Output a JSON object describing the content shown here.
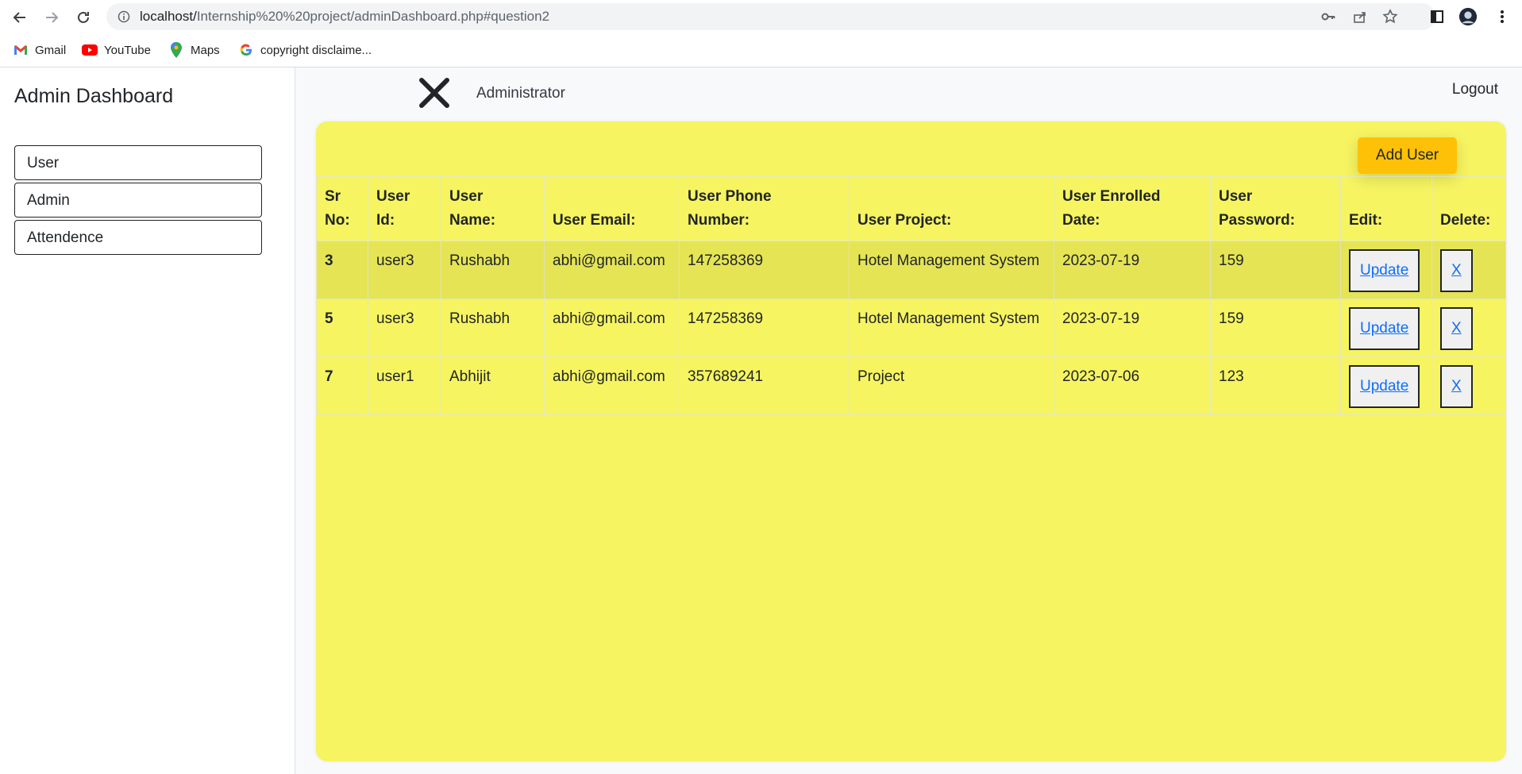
{
  "browser": {
    "url_host": "localhost/",
    "url_path": "Internship%20%20project/adminDashboard.php#question2",
    "bookmarks": [
      {
        "label": "Gmail",
        "icon": "gmail-icon"
      },
      {
        "label": "YouTube",
        "icon": "youtube-icon"
      },
      {
        "label": "Maps",
        "icon": "maps-icon"
      },
      {
        "label": "copyright disclaime...",
        "icon": "google-icon"
      }
    ]
  },
  "sidebar": {
    "title": "Admin Dashboard",
    "items": [
      {
        "label": "User"
      },
      {
        "label": "Admin"
      },
      {
        "label": "Attendence"
      }
    ]
  },
  "header": {
    "role": "Administrator",
    "logout": "Logout"
  },
  "panel": {
    "add_user": "Add User",
    "columns": [
      {
        "line1": "Sr",
        "line2": "No:"
      },
      {
        "line1": "User",
        "line2": "Id:"
      },
      {
        "line1": "User",
        "line2": "Name:"
      },
      {
        "line1": "",
        "line2": "User Email:"
      },
      {
        "line1": "User Phone",
        "line2": "Number:"
      },
      {
        "line1": "",
        "line2": "User Project:"
      },
      {
        "line1": "User Enrolled",
        "line2": "Date:"
      },
      {
        "line1": "User",
        "line2": "Password:"
      },
      {
        "line1": "",
        "line2": "Edit:"
      },
      {
        "line1": "",
        "line2": "Delete:"
      }
    ],
    "rows": [
      {
        "sr": "3",
        "id": "user3",
        "name": "Rushabh",
        "email": "abhi@gmail.com",
        "phone": "147258369",
        "project": "Hotel Management System",
        "date": "2023-07-19",
        "password": "159",
        "edit": "Update",
        "delete": "X"
      },
      {
        "sr": "5",
        "id": "user3",
        "name": "Rushabh",
        "email": "abhi@gmail.com",
        "phone": "147258369",
        "project": "Hotel Management System",
        "date": "2023-07-19",
        "password": "159",
        "edit": "Update",
        "delete": "X"
      },
      {
        "sr": "7",
        "id": "user1",
        "name": "Abhijit",
        "email": "abhi@gmail.com",
        "phone": "357689241",
        "project": "Project",
        "date": "2023-07-06",
        "password": "123",
        "edit": "Update",
        "delete": "X"
      }
    ]
  },
  "colors": {
    "panel": "#f6f461",
    "highlight_row": "#e5e455",
    "add_button": "#ffc107",
    "link": "#0d6efd"
  }
}
